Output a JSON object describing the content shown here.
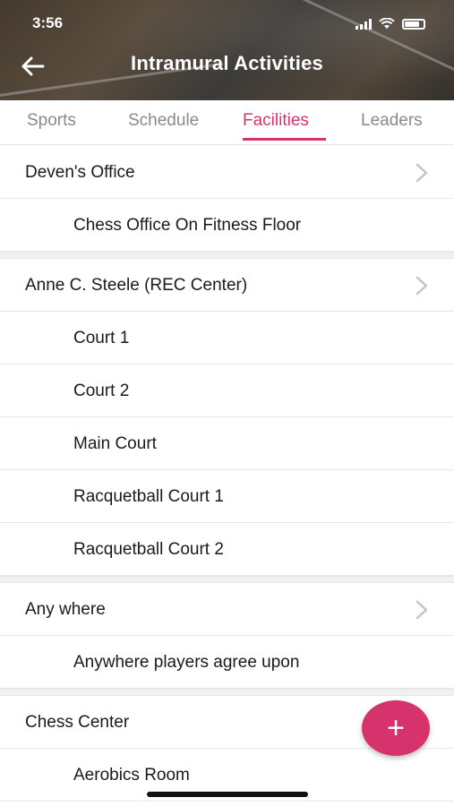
{
  "status": {
    "time": "3:56"
  },
  "header": {
    "title": "Intramural Activities"
  },
  "tabs": [
    {
      "label": "Sports",
      "active": false
    },
    {
      "label": "Schedule",
      "active": false
    },
    {
      "label": "Facilities",
      "active": true
    },
    {
      "label": "Leaders",
      "active": false
    }
  ],
  "groups": [
    {
      "name": "Deven's Office",
      "items": [
        "Chess Office On Fitness Floor"
      ]
    },
    {
      "name": "Anne C. Steele (REC Center)",
      "items": [
        "Court 1",
        "Court 2",
        "Main Court",
        "Racquetball Court 1",
        "Racquetball Court 2"
      ]
    },
    {
      "name": "Any where",
      "items": [
        "Anywhere players agree upon"
      ]
    },
    {
      "name": "Chess Center",
      "items": [
        "Aerobics Room"
      ]
    }
  ],
  "fab": {
    "label": "+"
  },
  "colors": {
    "accent": "#d6336c",
    "tab_inactive": "#8a8a8a"
  },
  "icons": {
    "back": "arrow-left-icon",
    "chevron": "chevron-right-icon",
    "add": "plus-icon"
  }
}
